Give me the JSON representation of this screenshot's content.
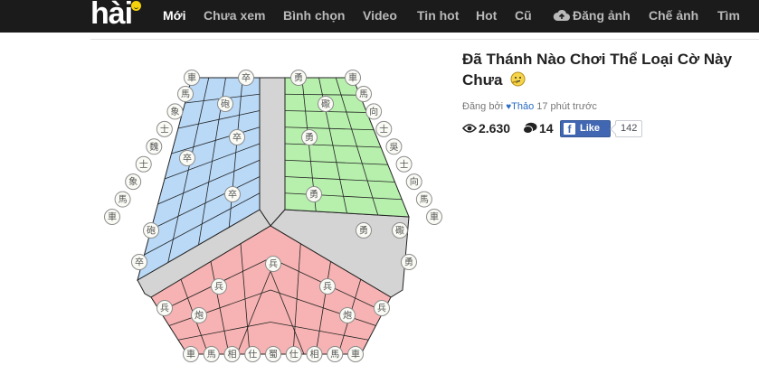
{
  "site": {
    "logo_text": "hài"
  },
  "nav": [
    {
      "label": "Mới",
      "active": true
    },
    {
      "label": "Chưa xem"
    },
    {
      "label": "Bình chọn"
    },
    {
      "label": "Video"
    },
    {
      "label": "Tin hot"
    },
    {
      "label": "Hot"
    },
    {
      "label": "Cũ"
    },
    {
      "label": "Đăng ảnh"
    },
    {
      "label": "Chế ảnh"
    },
    {
      "label": "Tìm"
    }
  ],
  "post": {
    "title": "Đã Thánh Nào Chơi Thể Loại Cờ Này Chưa",
    "meta_prefix": "Đăng bởi ",
    "author": "Thảo",
    "time": " 17 phút trước",
    "views": "2.630",
    "comments": "14",
    "like_label": "Like",
    "like_count": "142"
  },
  "board": {
    "colors": {
      "blue": "#b9d9f7",
      "green": "#b7f0ad",
      "red": "#f7b3b3",
      "gray": "#d4d4d4",
      "piece_fill": "#fbfbf6",
      "piece_text": "#555555"
    },
    "pieces": {
      "blue_top": [
        "車",
        "卒"
      ],
      "blue_inner": [
        "馬",
        "象",
        "士",
        "魏",
        "士",
        "象",
        "馬",
        "車"
      ],
      "blue_mid": [
        "砲",
        "卒",
        "卒",
        "卒",
        "砲",
        "卒"
      ],
      "green_top": [
        "勇",
        "車"
      ],
      "green_inner": [
        "馬",
        "向",
        "士",
        "吳",
        "士",
        "向",
        "馬",
        "車"
      ],
      "green_mid": [
        "礮",
        "勇",
        "勇",
        "勇",
        "礮",
        "勇"
      ],
      "red_bottom": [
        "車",
        "馬",
        "相",
        "仕",
        "蜀",
        "仕",
        "相",
        "馬",
        "車"
      ],
      "red_mid": [
        "兵",
        "兵",
        "兵",
        "兵",
        "兵",
        "炮",
        "炮"
      ]
    }
  }
}
